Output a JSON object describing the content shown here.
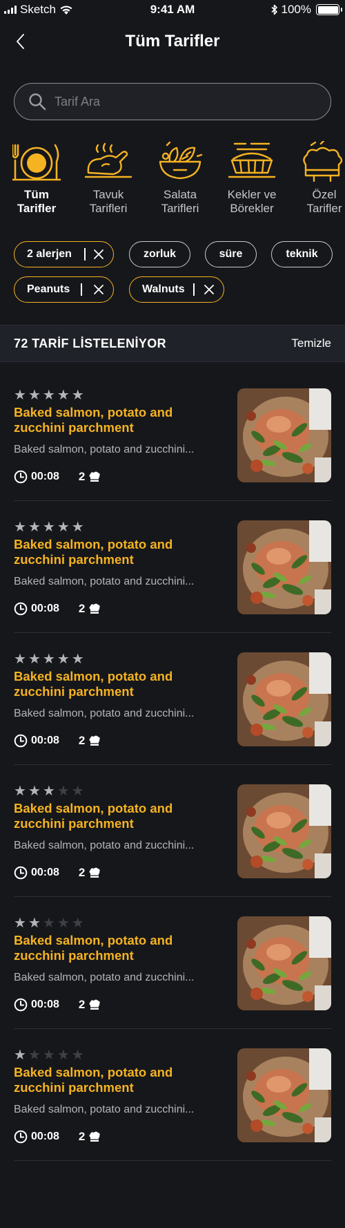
{
  "status_bar": {
    "carrier": "Sketch",
    "time": "9:41 AM",
    "battery": "100%"
  },
  "header": {
    "title": "Tüm Tarifler"
  },
  "search": {
    "placeholder": "Tarif Ara",
    "value": ""
  },
  "categories": [
    {
      "label": "Tüm\nTarifler",
      "icon": "dinner-plate-icon",
      "active": true
    },
    {
      "label": "Tavuk\nTarifleri",
      "icon": "roast-chicken-icon",
      "active": false
    },
    {
      "label": "Salata\nTarifleri",
      "icon": "salad-bowl-icon",
      "active": false
    },
    {
      "label": "Kekler ve\nBörekler",
      "icon": "pie-icon",
      "active": false
    },
    {
      "label": "Özel\nTarifler",
      "icon": "chef-hat-icon",
      "active": false
    }
  ],
  "filters": {
    "allergen": "2 alerjen",
    "difficulty": "zorluk",
    "duration": "süre",
    "technique": "teknik",
    "selected_1": "Peanuts",
    "selected_2": "Walnuts"
  },
  "results": {
    "count_label": "72 TARİF LİSTELENİYOR",
    "clear_label": "Temizle"
  },
  "recipes": [
    {
      "rating": 5,
      "title": "Baked salmon, potato and zucchini parchment",
      "description": "Baked salmon, potato and zucchini...",
      "time": "00:08",
      "servings": "2"
    },
    {
      "rating": 5,
      "title": "Baked salmon, potato and zucchini parchment",
      "description": "Baked salmon, potato and zucchini...",
      "time": "00:08",
      "servings": "2"
    },
    {
      "rating": 5,
      "title": "Baked salmon, potato and zucchini parchment",
      "description": "Baked salmon, potato and zucchini...",
      "time": "00:08",
      "servings": "2"
    },
    {
      "rating": 3,
      "title": "Baked salmon, potato and zucchini parchment",
      "description": "Baked salmon, potato and zucchini...",
      "time": "00:08",
      "servings": "2"
    },
    {
      "rating": 2,
      "title": "Baked salmon, potato and zucchini parchment",
      "description": "Baked salmon, potato and zucchini...",
      "time": "00:08",
      "servings": "2"
    },
    {
      "rating": 1,
      "title": "Baked salmon, potato and zucchini parchment",
      "description": "Baked salmon, potato and zucchini...",
      "time": "00:08",
      "servings": "2"
    }
  ],
  "colors": {
    "accent": "#f5b322",
    "background": "#16171b",
    "panel": "#1f2228",
    "muted_text": "#b3b5ba"
  }
}
